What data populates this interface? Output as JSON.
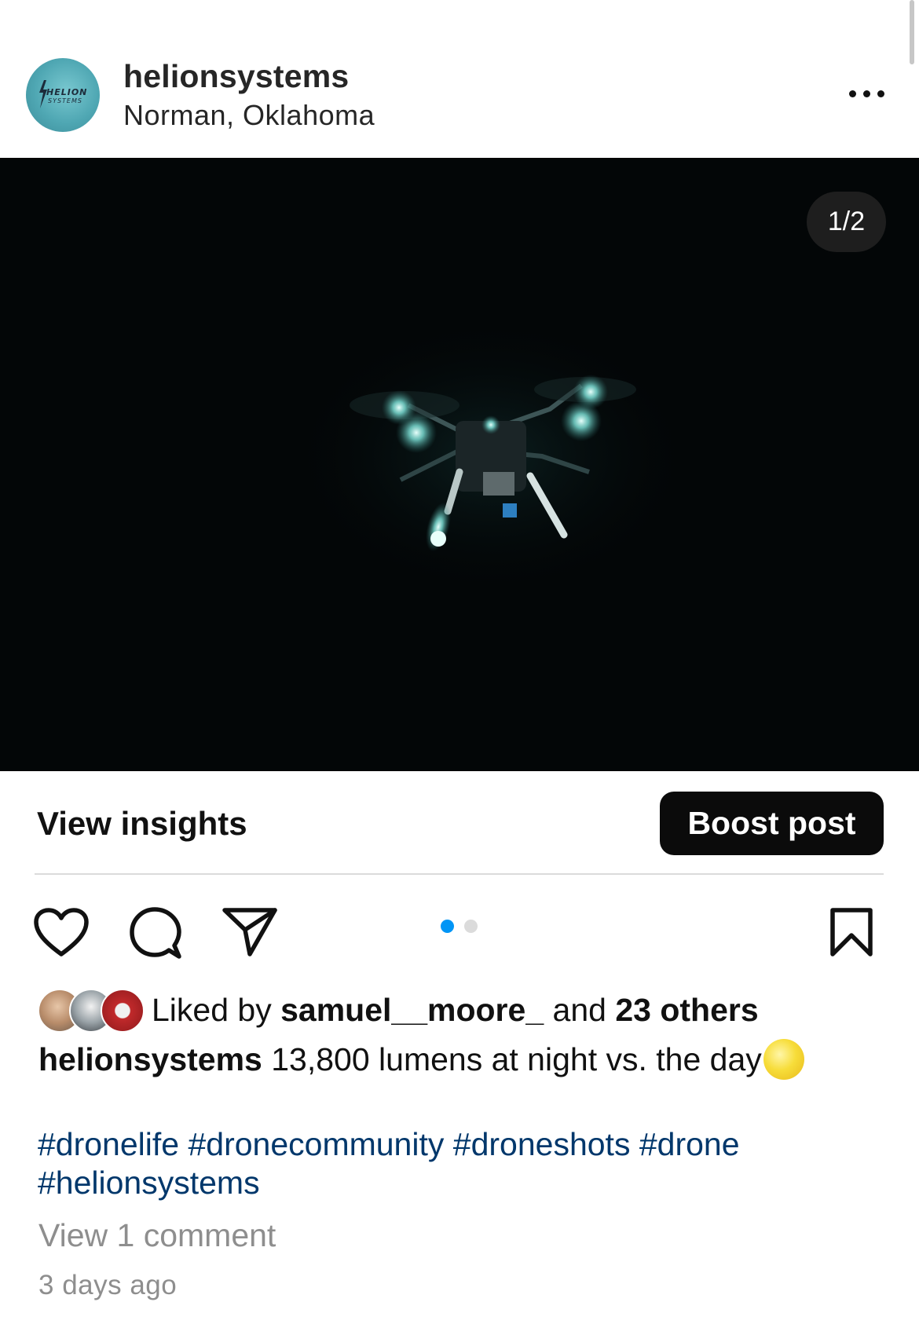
{
  "header": {
    "username": "helionsystems",
    "location": "Norman, Oklahoma",
    "avatar_logo_line1": "HELION",
    "avatar_logo_line2": "SYSTEMS",
    "more_icon": "more-horizontal-icon"
  },
  "media": {
    "counter": "1/2",
    "current_slide": 1,
    "total_slides": 2,
    "background_color": "#030607",
    "glow_color": "#7fe6dc"
  },
  "insights": {
    "view_insights_label": "View insights",
    "boost_label": "Boost post"
  },
  "actions": {
    "like_icon": "heart-icon",
    "comment_icon": "comment-icon",
    "share_icon": "send-icon",
    "save_icon": "bookmark-icon",
    "active_dot_color": "#0095f6",
    "inactive_dot_color": "#dbdbdb"
  },
  "likes": {
    "prefix": "Liked by ",
    "liker": "samuel__moore_",
    "middle": " and ",
    "others": "23 others"
  },
  "caption": {
    "username": "helionsystems",
    "text": " 13,800 lumens at night vs. the day",
    "emoji": "moon-emoji"
  },
  "hashtags": [
    "#dronelife",
    "#dronecommunity",
    "#droneshots",
    "#drone",
    "#helionsystems"
  ],
  "comments_link": "View 1 comment",
  "timestamp": "3 days ago",
  "colors": {
    "hashtag": "#00376b",
    "muted_text": "#8e8e8e",
    "primary_text": "#111111",
    "boost_bg": "#0b0b0b"
  }
}
